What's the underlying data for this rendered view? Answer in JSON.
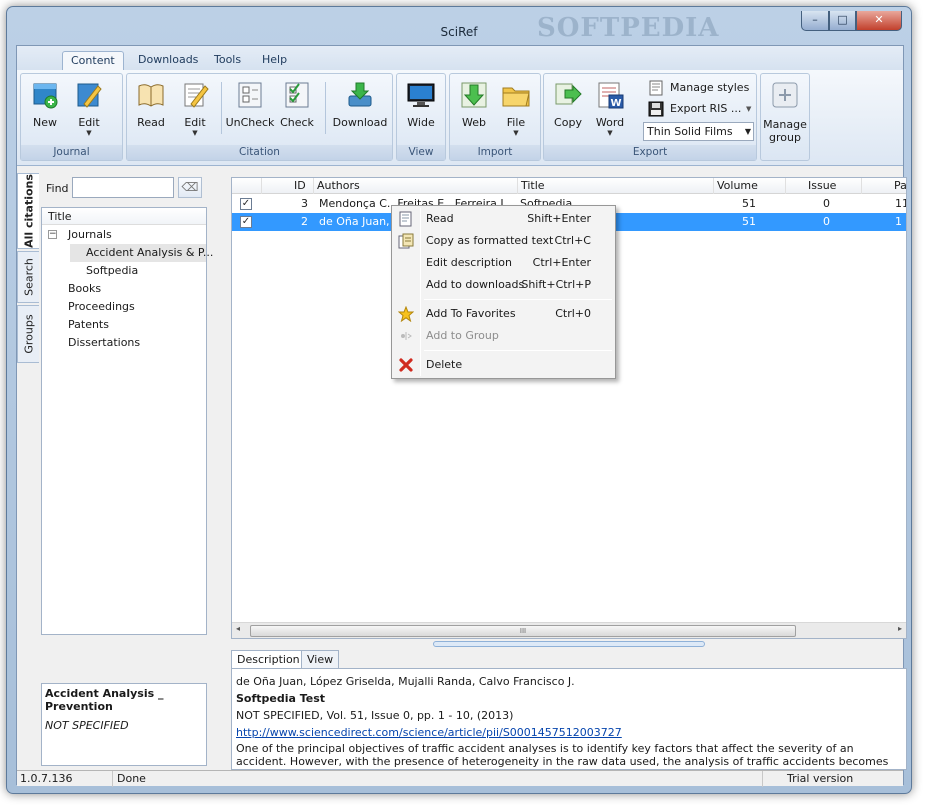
{
  "window": {
    "title": "SciRef",
    "watermark": "SOFTPEDIA",
    "controls": {
      "minimize": "–",
      "maximize": "□",
      "close": "✕"
    }
  },
  "ribbon": {
    "tabs": [
      "Content",
      "Downloads",
      "Tools",
      "Help"
    ],
    "active_tab": "Content",
    "groups": {
      "journal": {
        "label": "Journal",
        "new": "New",
        "edit": "Edit"
      },
      "citation": {
        "label": "Citation",
        "read": "Read",
        "edit": "Edit",
        "uncheck": "UnCheck",
        "check": "Check",
        "download": "Download"
      },
      "view": {
        "label": "View",
        "wide": "Wide"
      },
      "import": {
        "label": "Import",
        "web": "Web",
        "file": "File"
      },
      "export": {
        "label": "Export",
        "copy": "Copy",
        "word": "Word",
        "manage_styles": "Manage styles",
        "export_ris": "Export RIS ...",
        "style_select": "Thin Solid Films"
      },
      "manage_group": {
        "label_line1": "Manage",
        "label_line2": "group"
      }
    }
  },
  "side_tabs": [
    "All citations",
    "Search",
    "Groups"
  ],
  "left_panel": {
    "find_label": "Find",
    "find_value": "",
    "clear_glyph": "⌫",
    "tree_header": "Title",
    "tree": {
      "journals": "Journals",
      "journal_items": [
        "Accident Analysis & P...",
        "Softpedia"
      ],
      "others": [
        "Books",
        "Proceedings",
        "Patents",
        "Dissertations"
      ]
    },
    "info": {
      "title": "Accident Analysis _ Prevention",
      "subtitle": "NOT SPECIFIED"
    }
  },
  "grid": {
    "columns": [
      "ID",
      "Authors",
      "Title",
      "Volume",
      "Issue",
      "Pa"
    ],
    "rows": [
      {
        "checked": true,
        "id": "3",
        "authors": "Mendonça C., Freitas E., Ferreira J....",
        "title": "Softpedia",
        "volume": "51",
        "issue": "0",
        "pages": "11"
      },
      {
        "checked": true,
        "id": "2",
        "authors": "de Oña Juan, Ló",
        "title": "",
        "volume": "51",
        "issue": "0",
        "pages": "1"
      }
    ],
    "scroll_grip": "III",
    "scroll_left": "◂",
    "scroll_right": "▸"
  },
  "context_menu": [
    {
      "label": "Read",
      "shortcut": "Shift+Enter",
      "icon": "read-icon",
      "enabled": true
    },
    {
      "label": "Copy as formatted text",
      "shortcut": "Ctrl+C",
      "icon": "copy-formatted-icon",
      "enabled": true
    },
    {
      "label": "Edit description",
      "shortcut": "Ctrl+Enter",
      "icon": "",
      "enabled": true
    },
    {
      "label": "Add to downloads",
      "shortcut": "Shift+Ctrl+P",
      "icon": "",
      "enabled": true
    },
    {
      "label": "Add To Favorites",
      "shortcut": "Ctrl+0",
      "icon": "star-icon",
      "enabled": true
    },
    {
      "label": "Add to Group",
      "shortcut": "",
      "icon": "group-icon",
      "enabled": false
    },
    {
      "label": "Delete",
      "shortcut": "",
      "icon": "delete-icon",
      "enabled": true
    }
  ],
  "description": {
    "tabs": [
      "Description",
      "View PDF"
    ],
    "active_tab": "Description",
    "authors": "de Oña Juan, López Griselda, Mujalli Randa, Calvo Francisco J.",
    "title": "Softpedia Test",
    "citation": "NOT SPECIFIED,  Vol. 51,  Issue 0,  pp. 1 - 10, (2013)",
    "url": "http://www.sciencedirect.com/science/article/pii/S0001457512003727",
    "abstract": "One of the principal objectives of traffic accident analyses is to identify key factors that affect the severity of an accident. However, with the presence of heterogeneity in the raw data used, the analysis of traffic accidents becomes difficult. In this paper, Latent Class Cluster"
  },
  "status": {
    "version": "1.0.7.136",
    "state": "Done",
    "license": "Trial version"
  },
  "colors": {
    "selection": "#3399ff",
    "link": "#0645ad",
    "frame": "#a7bfd9"
  }
}
